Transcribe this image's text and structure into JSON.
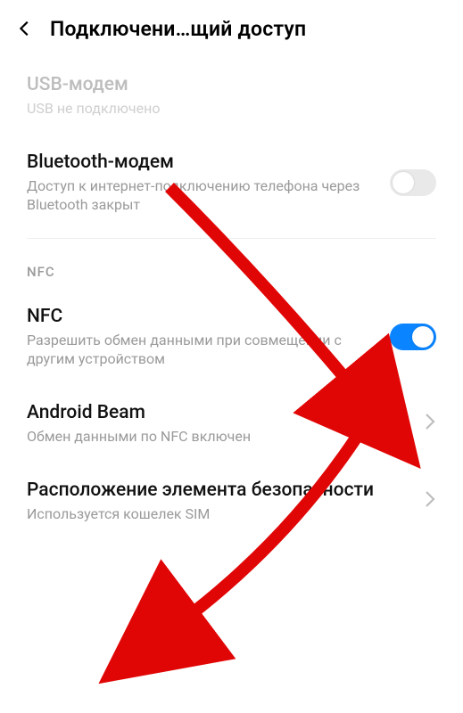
{
  "header": {
    "title": "Подключени…щий доступ"
  },
  "items": {
    "usb": {
      "title": "USB-модем",
      "sub": "USB не подключено"
    },
    "bt": {
      "title": "Bluetooth-модем",
      "sub": "Доступ к интернет-подключению телефона через Bluetooth закрыт"
    },
    "nfc_header": "NFC",
    "nfc": {
      "title": "NFC",
      "sub": "Разрешить обмен данными при совмещении с другим устройством",
      "on": true
    },
    "beam": {
      "title": "Android Beam",
      "sub": "Обмен данными по NFC включен"
    },
    "secure": {
      "title": "Расположение элемента безопасности",
      "sub": "Используется кошелек SIM"
    }
  },
  "colors": {
    "accent": "#0a84ff",
    "arrow": "#e10606"
  }
}
